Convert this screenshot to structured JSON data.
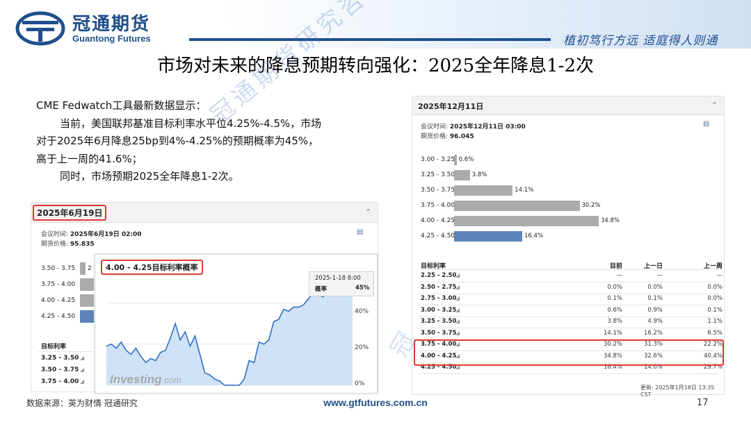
{
  "header": {
    "logo_cn": "冠通期货",
    "logo_en": "Guantong Futures",
    "slogan": "植初笃行方远  适庭得人则通"
  },
  "slide": {
    "title": "市场对未来的降息预期转向强化：2025全年降息1-2次",
    "body": [
      "CME Fedwatch工具最新数据显示：",
      "当前，美国联邦基准目标利率水平位4.25%-4.5%，市场",
      "对于2025年6月降息25bp到4%-4.25%的预期概率为45%，",
      "高于上一周的41.6%；",
      "同时，市场预期2025全年降息1-2次。"
    ],
    "watermark": "冠通期货研究咨询部"
  },
  "left_panel": {
    "date": "2025年6月19日",
    "meeting_label": "会议时间:",
    "meeting_time": "2025年6月19日 02:00",
    "price_label": "期货价格:",
    "price": "95.835",
    "rows": [
      {
        "range": "3.50 - 3.75",
        "value": "2"
      },
      {
        "range": "3.75 - 4.00",
        "value": ""
      },
      {
        "range": "4.00 - 4.25",
        "value": ""
      },
      {
        "range": "4.25 - 4.50",
        "value": ""
      }
    ],
    "table_header": "目标利率",
    "table_rows": [
      "3.25 - 3.50",
      "3.50 - 3.75",
      "3.75 - 4.00"
    ]
  },
  "overlay_chart": {
    "title": "4.00 - 4.25目标利率概率",
    "tooltip_date": "2025-1-18 8:00",
    "tooltip_label": "概率",
    "tooltip_value": "45%",
    "brand": "Investing",
    "brand_suffix": ".com",
    "y_ticks": [
      "40%",
      "20%",
      "0%"
    ]
  },
  "right_panel": {
    "date": "2025年12月11日",
    "meeting_label": "会议时间:",
    "meeting_time": "2025年12月11日 03:00",
    "price_label": "期货价格:",
    "price": "96.045",
    "table_headers": [
      "目标利率",
      "目前",
      "上一日",
      "上一周"
    ],
    "table_rows": [
      {
        "range": "2.25 - 2.50",
        "now": "—",
        "prev_day": "—",
        "prev_week": "—"
      },
      {
        "range": "2.50 - 2.75",
        "now": "0.0%",
        "prev_day": "0.0%",
        "prev_week": "0.0%"
      },
      {
        "range": "2.75 - 3.00",
        "now": "0.1%",
        "prev_day": "0.1%",
        "prev_week": "0.0%"
      },
      {
        "range": "3.00 - 3.25",
        "now": "0.6%",
        "prev_day": "0.9%",
        "prev_week": "0.1%"
      },
      {
        "range": "3.25 - 3.50",
        "now": "3.8%",
        "prev_day": "4.9%",
        "prev_week": "1.1%"
      },
      {
        "range": "3.50 - 3.75",
        "now": "14.1%",
        "prev_day": "16.2%",
        "prev_week": "6.5%"
      },
      {
        "range": "3.75 - 4.00",
        "now": "30.2%",
        "prev_day": "31.3%",
        "prev_week": "22.2%"
      },
      {
        "range": "4.00 - 4.25",
        "now": "34.8%",
        "prev_day": "32.6%",
        "prev_week": "40.4%"
      },
      {
        "range": "4.25 - 4.50",
        "now": "16.4%",
        "prev_day": "14.0%",
        "prev_week": "29.7%"
      }
    ],
    "update_note": "更新: 2025年1月18日 13:35 CST"
  },
  "chart_data": [
    {
      "type": "bar",
      "title": "2025年12月11日",
      "categories": [
        "3.00 - 3.25",
        "3.25 - 3.50",
        "3.50 - 3.75",
        "3.75 - 4.00",
        "4.00 - 4.25",
        "4.25 - 4.50"
      ],
      "values": [
        0.6,
        3.8,
        14.1,
        30.2,
        34.8,
        16.4
      ],
      "value_labels": [
        "0.6%",
        "3.8%",
        "14.1%",
        "30.2%",
        "34.8%",
        "16.4%"
      ],
      "orientation": "horizontal",
      "highlight_category": "4.25 - 4.50",
      "colors": {
        "bar": "#ababab",
        "highlight": "#5c84b8"
      }
    },
    {
      "type": "area",
      "title": "4.00 - 4.25目标利率概率",
      "ylim": [
        0,
        50
      ],
      "y_ticks": [
        0,
        20,
        40
      ],
      "x": [
        0,
        2,
        4,
        6,
        8,
        10,
        12,
        14,
        16,
        18,
        20,
        22,
        24,
        26,
        28,
        30,
        32,
        34,
        36,
        38,
        40,
        42,
        44,
        46,
        48,
        50,
        52,
        54,
        56,
        58,
        60,
        62,
        64,
        66,
        68,
        70,
        72,
        74,
        76,
        78,
        80,
        82,
        84,
        86,
        88,
        90,
        92,
        94,
        96,
        98,
        100
      ],
      "values": [
        19,
        20,
        18,
        21,
        17,
        15,
        18,
        14,
        11,
        13,
        12,
        16,
        17,
        23,
        30,
        22,
        26,
        19,
        24,
        15,
        6,
        5,
        3,
        2,
        0,
        0,
        0,
        0,
        3,
        12,
        11,
        21,
        20,
        22,
        31,
        32,
        37,
        36,
        38,
        38,
        39,
        42,
        45,
        44,
        43,
        45,
        46,
        46,
        44,
        46,
        45
      ],
      "last_value": 45,
      "colors": {
        "line": "#2f6fc2",
        "fill": "#cfe2f7"
      }
    }
  ],
  "footer": {
    "source": "数据来源：英为财情  冠通研究",
    "url": "www.gtfutures.com.cn",
    "page": "17"
  }
}
